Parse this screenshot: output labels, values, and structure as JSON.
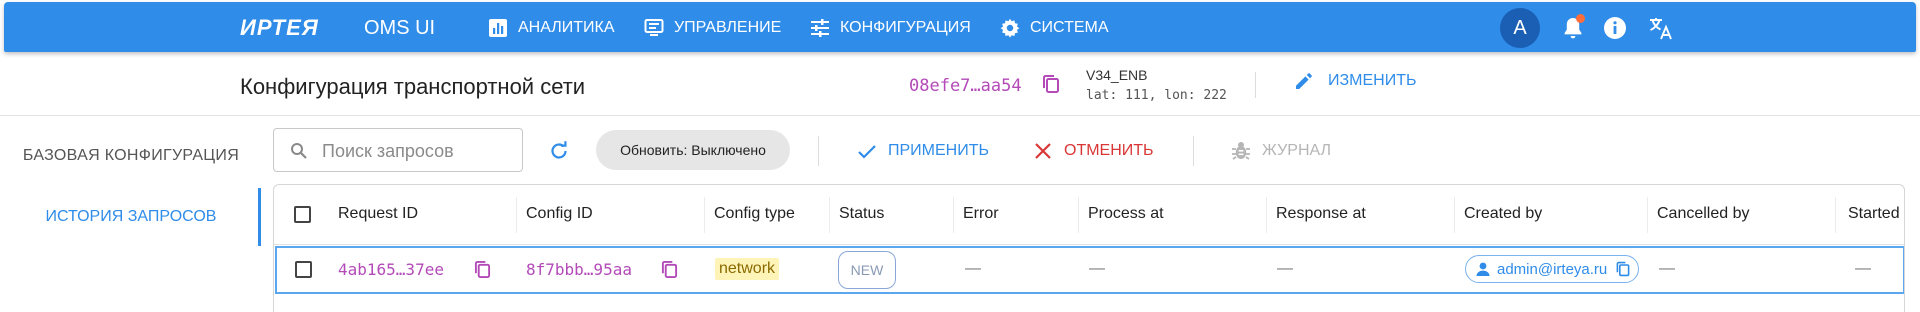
{
  "appbar": {
    "brand": "ИРТЕЯ",
    "product": "OMS UI",
    "nav": [
      {
        "label": "АНАЛИТИКА",
        "icon": "analytics-icon"
      },
      {
        "label": "УПРАВЛЕНИЕ",
        "icon": "monitor-icon"
      },
      {
        "label": "КОНФИГУРАЦИЯ",
        "icon": "sliders-icon"
      },
      {
        "label": "СИСТЕМА",
        "icon": "gear-icon"
      }
    ],
    "avatar_letter": "A",
    "has_notification": true
  },
  "header": {
    "title": "Конфигурация транспортной сети",
    "hash": "08efe7…aa54",
    "enb": "V34_ENB",
    "coords": "lat: 111, lon: 222",
    "edit_label": "ИЗМЕНИТЬ"
  },
  "sidebar": {
    "items": [
      {
        "label": "БАЗОВАЯ КОНФИГУРАЦИЯ",
        "active": false
      },
      {
        "label": "ИСТОРИЯ ЗАПРОСОВ",
        "active": true
      }
    ]
  },
  "toolbar": {
    "search_placeholder": "Поиск запросов",
    "search_value": "",
    "auto_refresh_label": "Обновить: Выключено",
    "apply_label": "ПРИМЕНИТЬ",
    "cancel_label": "ОТМЕНИТЬ",
    "log_label": "ЖУРНАЛ"
  },
  "table": {
    "columns": [
      "Request ID",
      "Config ID",
      "Config type",
      "Status",
      "Error",
      "Process at",
      "Response at",
      "Created by",
      "Cancelled by",
      "Started"
    ],
    "rows": [
      {
        "request_id": "4ab165…37ee",
        "config_id": "8f7bbb…95aa",
        "config_type": "network",
        "status": "NEW",
        "error": "—",
        "process_at": "—",
        "response_at": "—",
        "created_by": "admin@irteya.ru",
        "cancelled_by": "—",
        "started": "—"
      }
    ]
  },
  "colors": {
    "primary": "#2f8ce8",
    "hash": "#b34ab8",
    "danger": "#d93636",
    "tag_bg": "#fff4b8",
    "notification": "#ff6d3a"
  }
}
